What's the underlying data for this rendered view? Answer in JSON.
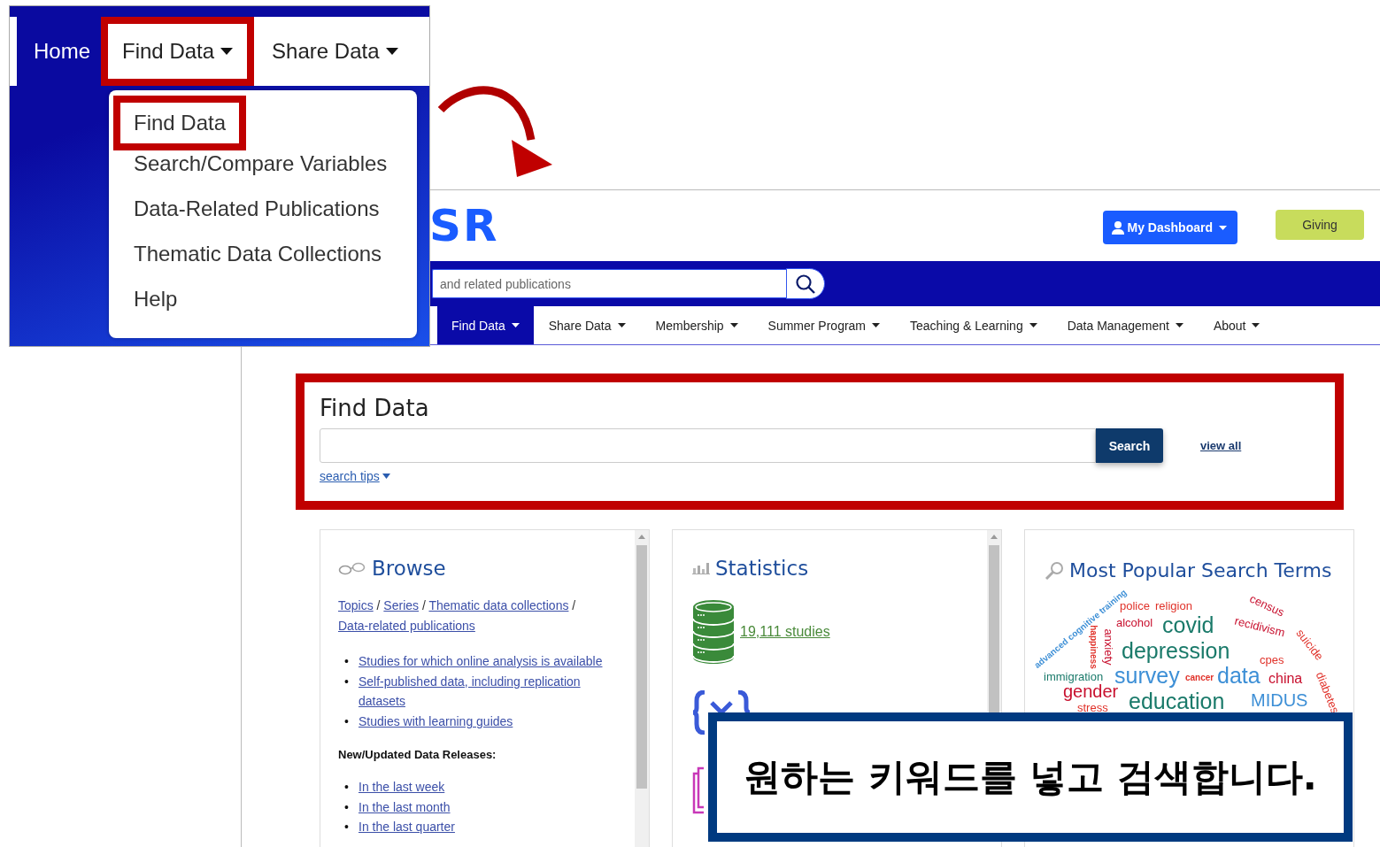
{
  "inset": {
    "nav": [
      {
        "label": "Home",
        "kind": "home",
        "highlighted": false
      },
      {
        "label": "Find Data",
        "kind": "dropdown",
        "highlighted": true
      },
      {
        "label": "Share Data",
        "kind": "dropdown",
        "highlighted": false
      }
    ],
    "menu": [
      {
        "label": "Find Data",
        "highlighted": true
      },
      {
        "label": "Search/Compare Variables",
        "highlighted": false
      },
      {
        "label": "Data-Related Publications",
        "highlighted": false
      },
      {
        "label": "Thematic Data Collections",
        "highlighted": false
      },
      {
        "label": "Help",
        "highlighted": false
      }
    ]
  },
  "header": {
    "logo": "SR",
    "dashboard_button": "My Dashboard",
    "giving_button": "Giving"
  },
  "site_search": {
    "placeholder": "and related publications"
  },
  "nav": [
    {
      "label": "Find Data",
      "selected": true
    },
    {
      "label": "Share Data",
      "selected": false
    },
    {
      "label": "Membership",
      "selected": false
    },
    {
      "label": "Summer Program",
      "selected": false
    },
    {
      "label": "Teaching & Learning",
      "selected": false
    },
    {
      "label": "Data Management",
      "selected": false
    },
    {
      "label": "About",
      "selected": false
    }
  ],
  "find_data": {
    "title": "Find Data",
    "highlighted": true,
    "search_button": "Search",
    "view_all": "view all",
    "search_tips": "search tips"
  },
  "browse": {
    "title": "Browse",
    "breadcrumb": [
      {
        "text": "Topics",
        "kind": "link"
      },
      {
        "text": "/",
        "kind": "separator"
      },
      {
        "text": "Series",
        "kind": "link"
      },
      {
        "text": "/",
        "kind": "separator"
      },
      {
        "text": "Thematic data collections",
        "kind": "link"
      },
      {
        "text": "/",
        "kind": "separator"
      },
      {
        "text": "Data-related publications",
        "kind": "link"
      }
    ],
    "featured": [
      {
        "marker": "•",
        "text": "Studies for which online analysis is available"
      },
      {
        "marker": "•",
        "text": "Self-published data, including replication datasets"
      },
      {
        "marker": "•",
        "text": "Studies with learning guides"
      }
    ],
    "releases_heading": "New/Updated Data Releases:",
    "releases": [
      {
        "marker": "•",
        "text": "In the last week"
      },
      {
        "marker": "•",
        "text": "In the last month"
      },
      {
        "marker": "•",
        "text": "In the last quarter"
      }
    ]
  },
  "statistics": {
    "title": "Statistics",
    "studies": "19,111 studies"
  },
  "popular": {
    "title": "Most Popular Search Terms",
    "terms": [
      {
        "text": "advanced cognitive training",
        "color": "#3d8fd6"
      },
      {
        "text": "police",
        "color": "#e0322a"
      },
      {
        "text": "religion",
        "color": "#e0322a"
      },
      {
        "text": "census",
        "color": "#c8102e"
      },
      {
        "text": "alcohol",
        "color": "#c8102e"
      },
      {
        "text": "covid",
        "color": "#1a7a6a"
      },
      {
        "text": "recidivism",
        "color": "#c8102e"
      },
      {
        "text": "happiness",
        "color": "#e0322a"
      },
      {
        "text": "anxiety",
        "color": "#c8102e"
      },
      {
        "text": "depression",
        "color": "#1a7a6a"
      },
      {
        "text": "suicide",
        "color": "#e0322a"
      },
      {
        "text": "cpes",
        "color": "#e0322a"
      },
      {
        "text": "immigration",
        "color": "#1a7a6a"
      },
      {
        "text": "survey",
        "color": "#3d8fd6"
      },
      {
        "text": "data",
        "color": "#3d8fd6"
      },
      {
        "text": "china",
        "color": "#c8102e"
      },
      {
        "text": "diabetes",
        "color": "#e0322a"
      },
      {
        "text": "gender",
        "color": "#c8102e"
      },
      {
        "text": "cancer",
        "color": "#e0322a"
      },
      {
        "text": "education",
        "color": "#1a7a6a"
      },
      {
        "text": "MIDUS",
        "color": "#3d8fd6"
      },
      {
        "text": "stress",
        "color": "#e0322a"
      }
    ]
  },
  "callout": {
    "text": "원하는 키워드를 넣고 검색합니다."
  }
}
